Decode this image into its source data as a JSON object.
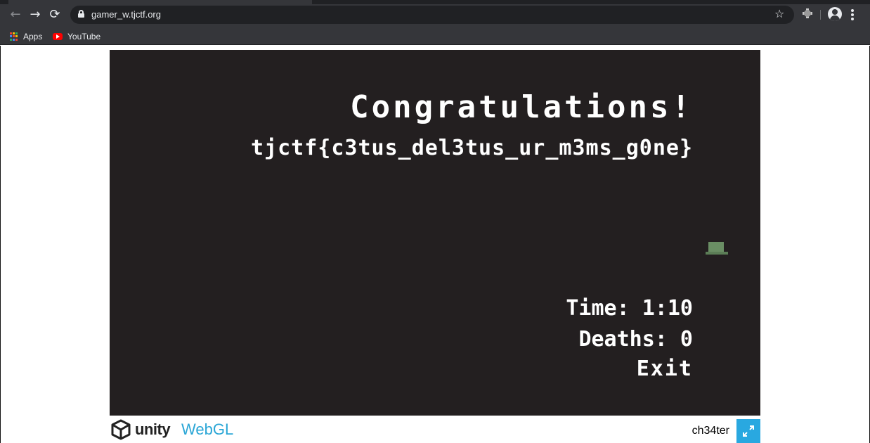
{
  "browser": {
    "url": "gamer_w.tjctf.org",
    "bookmarks": [
      {
        "label": "Apps",
        "icon": "apps-grid-icon"
      },
      {
        "label": "YouTube",
        "icon": "youtube-icon"
      }
    ],
    "icons": {
      "back": "back-arrow-icon",
      "forward": "forward-arrow-icon",
      "reload": "reload-icon",
      "lock": "lock-icon",
      "bookmark_star": "star-icon",
      "extension": "extension-icon",
      "profile": "profile-icon",
      "menu": "kebab-menu-icon"
    }
  },
  "game": {
    "heading": "Congratulations!",
    "flag": "tjctf{c3tus_del3tus_ur_m3ms_g0ne}",
    "time_label": "Time: 1:10",
    "deaths_label": "Deaths: 0",
    "exit_label": "Exit",
    "background_color": "#231f20",
    "text_color": "#ffffff",
    "block_color": "#6a8e64"
  },
  "footer": {
    "brand": "unity",
    "product": "WebGL",
    "game_title": "ch34ter",
    "brand_color": "#222222",
    "product_color": "#2aa6d6",
    "fullscreen_color": "#29a8e0"
  }
}
